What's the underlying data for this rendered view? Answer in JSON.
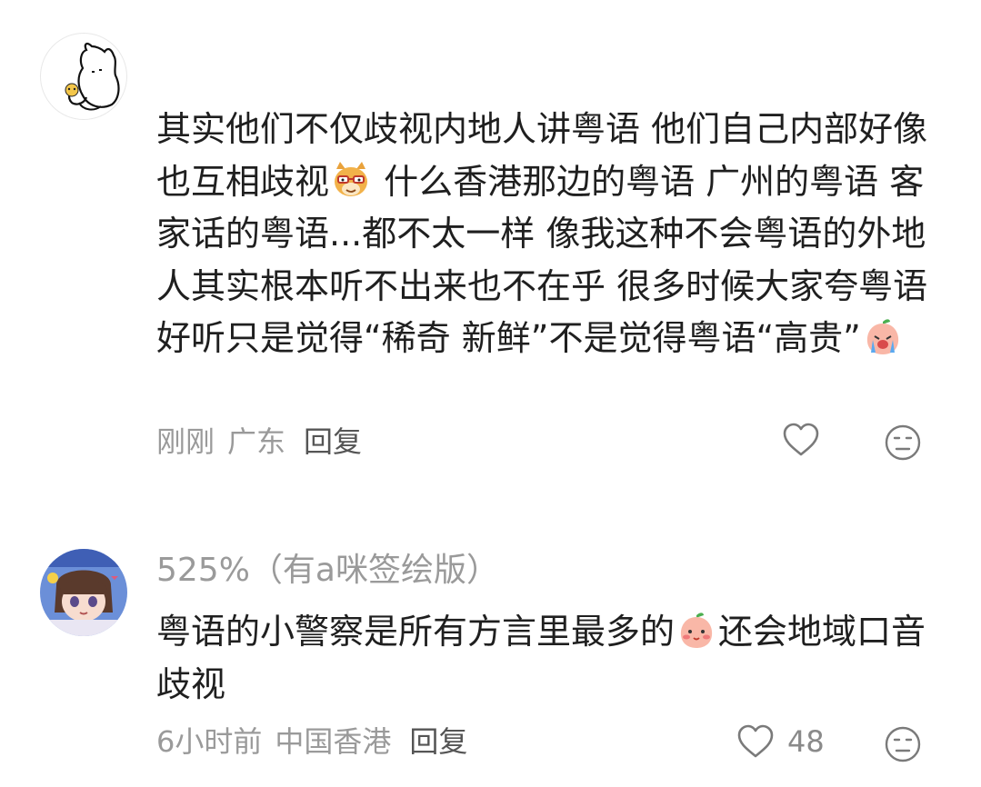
{
  "comments": [
    {
      "author": "",
      "text_part1": "其实他们不仅歧视内地人讲粤语 他们自己内部好像也互相歧视",
      "text_part2": " 什么香港那边的粤语 广州的粤语 客家话的粤语...都不太一样 像我这种不会粤语的外地人其实根本听不出来也不在乎 很多时候大家夸粤语好听只是觉得“稀奇 新鲜”不是觉得粤语“高贵”",
      "emoji1": "dog-sunglasses-emoji",
      "emoji2": "crying-peach-emoji",
      "time": "刚刚",
      "location": "广东",
      "reply": "回复",
      "like_count": "",
      "icons": {
        "like": "heart-outline-icon",
        "dislike": "meh-face-icon"
      }
    },
    {
      "author": "525%（有a咪签绘版）",
      "text_part1": "粤语的小警察是所有方言里最多的",
      "text_part2": "还会地域口音歧视",
      "emoji1": "blushing-peach-emoji",
      "time": "6小时前",
      "location": "中国香港",
      "reply": "回复",
      "like_count": "48",
      "icons": {
        "like": "heart-outline-icon",
        "dislike": "meh-face-icon"
      }
    }
  ],
  "colors": {
    "text": "#1f1f1f",
    "meta": "#9a9a9a",
    "icon": "#8a8a8a"
  }
}
